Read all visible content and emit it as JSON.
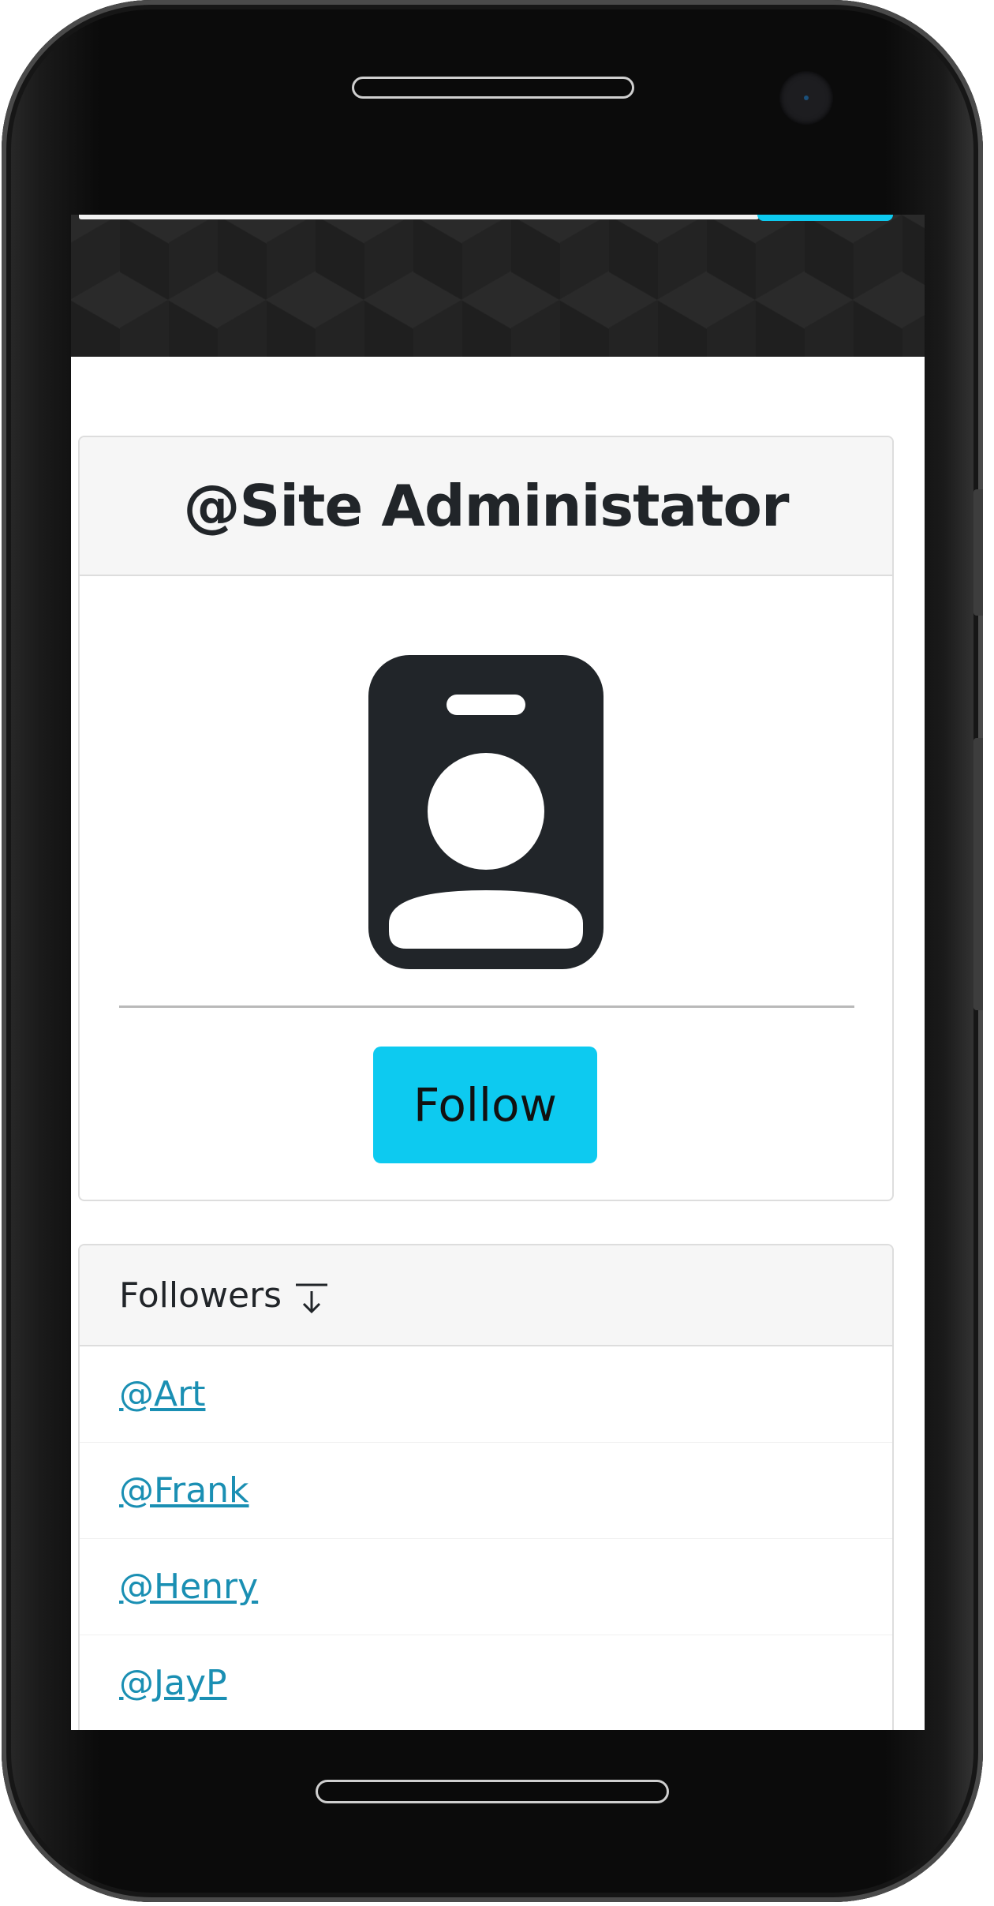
{
  "profile": {
    "username": "@Site Administator",
    "avatar_icon": "person-badge-icon",
    "follow_label": "Follow"
  },
  "followers": {
    "title": "Followers",
    "sort_icon": "sort-down-icon",
    "items": [
      {
        "label": "@Art"
      },
      {
        "label": "@Frank"
      },
      {
        "label": "@Henry"
      },
      {
        "label": "@JayP"
      }
    ]
  },
  "colors": {
    "accent": "#0dcaf0",
    "link": "#1a8fb3",
    "text": "#212529",
    "card_header_bg": "#f6f6f6",
    "hero_bg": "#232323"
  }
}
